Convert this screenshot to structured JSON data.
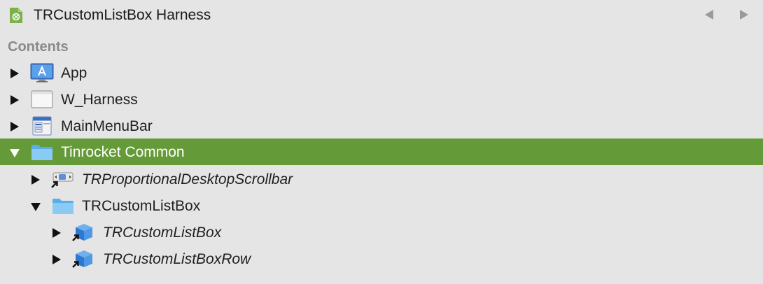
{
  "window": {
    "title": "TRCustomListBox Harness",
    "doc_icon": "project-doc-icon",
    "back_icon": "triangle-left-icon",
    "forward_icon": "triangle-right-icon"
  },
  "contents": {
    "header": "Contents",
    "selected_color": "#659a39",
    "items": [
      {
        "label": "App",
        "icon": "app-icon",
        "expanded": false,
        "italic": false,
        "selected": false
      },
      {
        "label": "W_Harness",
        "icon": "window-icon",
        "expanded": false,
        "italic": false,
        "selected": false
      },
      {
        "label": "MainMenuBar",
        "icon": "menubar-icon",
        "expanded": false,
        "italic": false,
        "selected": false
      },
      {
        "label": "Tinrocket Common",
        "icon": "folder-icon",
        "expanded": true,
        "italic": false,
        "selected": true,
        "children": [
          {
            "label": "TRProportionalDesktopScrollbar",
            "icon": "scrollbar-alias-icon",
            "expanded": false,
            "italic": true,
            "selected": false
          },
          {
            "label": "TRCustomListBox",
            "icon": "folder-icon",
            "expanded": true,
            "italic": false,
            "selected": false,
            "children": [
              {
                "label": "TRCustomListBox",
                "icon": "class-alias-icon",
                "expanded": false,
                "italic": true,
                "selected": false
              },
              {
                "label": "TRCustomListBoxRow",
                "icon": "class-alias-icon",
                "expanded": false,
                "italic": true,
                "selected": false
              }
            ]
          }
        ]
      }
    ]
  }
}
